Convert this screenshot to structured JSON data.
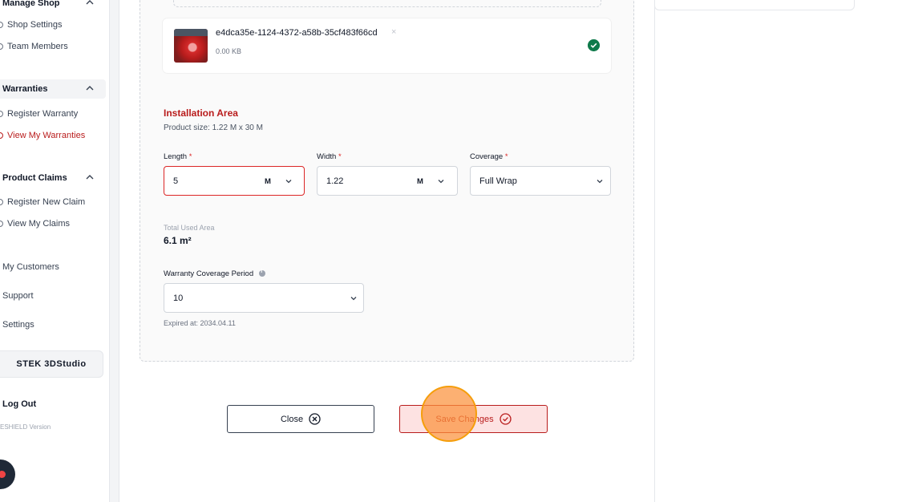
{
  "sidebar": {
    "manage_shop_label": "Manage Shop",
    "shop_settings_label": "Shop Settings",
    "team_members_label": "Team Members",
    "warranties_label": "Warranties",
    "register_warranty_label": "Register Warranty",
    "view_my_warranties_label": "View My Warranties",
    "product_claims_label": "Product Claims",
    "register_new_claim_label": "Register New Claim",
    "view_my_claims_label": "View My Claims",
    "my_customers_label": "My Customers",
    "support_label": "Support",
    "settings_label": "Settings",
    "brand_label": "STEK 3DStudio",
    "logout_label": "Log Out",
    "version_label": "ESHIELD Version",
    "active_color": "#b91c1c"
  },
  "file": {
    "name": "e4dca35e-1124-4372-a58b-35cf483f66cd",
    "remove_glyph": "×",
    "size": "0.00 KB",
    "status_icon": "check-circle-icon"
  },
  "installation": {
    "title": "Installation Area",
    "product_size": "Product size: 1.22 M x 30 M",
    "length_label": "Length",
    "length_value": "5",
    "length_unit": "M",
    "width_label": "Width",
    "width_value": "1.22",
    "width_unit": "M",
    "coverage_label": "Coverage",
    "coverage_value": "Full Wrap",
    "required_mark": "*",
    "total_used_area_label": "Total Used Area",
    "total_used_area_value": "6.1 m²",
    "warranty_period_label": "Warranty Coverage Period",
    "warranty_period_value": "10",
    "expired_text": "Expired at: 2034.04.11"
  },
  "actions": {
    "close_label": "Close",
    "save_label": "Save Changes"
  },
  "colors": {
    "accent": "#b91c1c",
    "success": "#0f7a4b",
    "cursor": "#fb923c"
  }
}
